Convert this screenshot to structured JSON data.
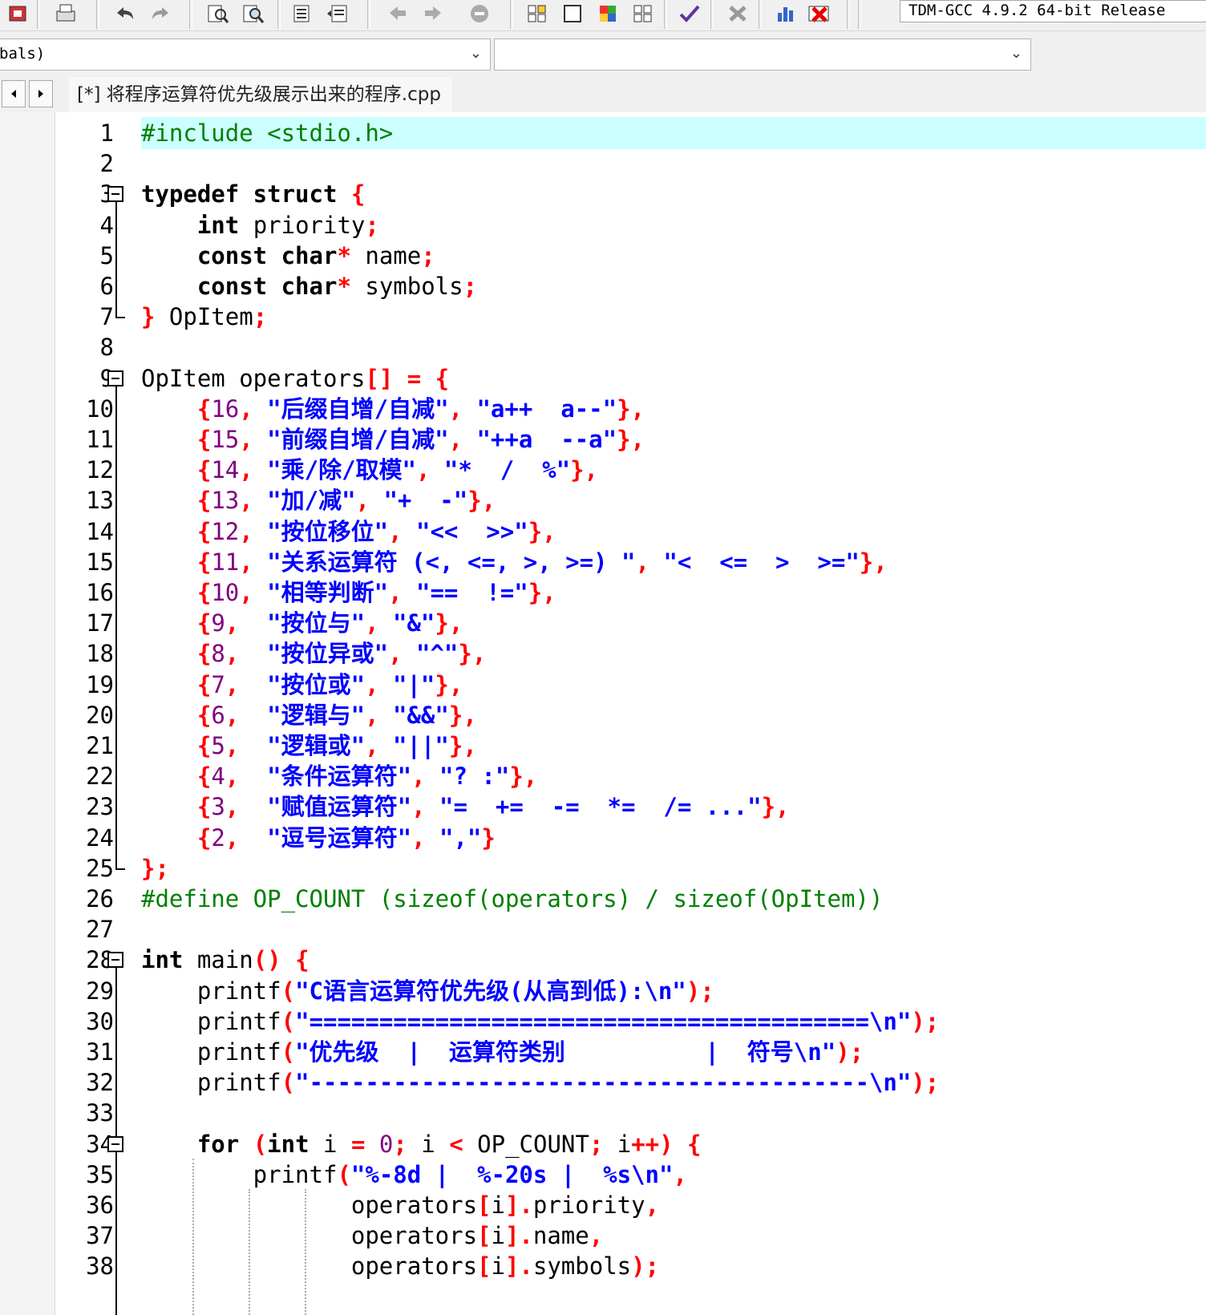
{
  "toolbar": {
    "compiler": "TDM-GCC 4.9.2 64-bit Release",
    "icons": [
      "new-project-icon",
      "print-icon",
      "undo-icon",
      "redo-icon",
      "find-icon",
      "replace-icon",
      "indent-icon",
      "unindent-icon",
      "bookmark-back-icon",
      "bookmark-forward-icon",
      "stop-icon",
      "new-class-icon",
      "window-icon",
      "color-grid-icon",
      "tile-icon",
      "check-syntax-icon",
      "close-x-icon",
      "chart-icon",
      "delete-red-icon"
    ]
  },
  "scope": {
    "left_value": "bals)",
    "right_value": ""
  },
  "tab": {
    "title": "[*] 将程序运算符优先级展示出来的程序.cpp"
  },
  "colors": {
    "keyword": "#000000",
    "symbol": "#ff0000",
    "number": "#800080",
    "string": "#0000ff",
    "preprocessor": "#008000",
    "current_line": "#ccffff"
  },
  "code": {
    "line_numbers": [
      "1",
      "2",
      "3",
      "4",
      "5",
      "6",
      "7",
      "8",
      "9",
      "10",
      "11",
      "12",
      "13",
      "14",
      "15",
      "16",
      "17",
      "18",
      "19",
      "20",
      "21",
      "22",
      "23",
      "24",
      "25",
      "26",
      "27",
      "28",
      "29",
      "30",
      "31",
      "32",
      "33",
      "34",
      "35",
      "36",
      "37",
      "38"
    ],
    "lines": [
      [
        [
          "pre",
          "#include <stdio.h>"
        ]
      ],
      [],
      [
        [
          "kw",
          "typedef struct "
        ],
        [
          "sym",
          "{"
        ]
      ],
      [
        [
          "txt",
          "    "
        ],
        [
          "kw",
          "int"
        ],
        [
          "txt",
          " priority"
        ],
        [
          "sym",
          ";"
        ]
      ],
      [
        [
          "txt",
          "    "
        ],
        [
          "kw",
          "const char"
        ],
        [
          "sym",
          "*"
        ],
        [
          "txt",
          " name"
        ],
        [
          "sym",
          ";"
        ]
      ],
      [
        [
          "txt",
          "    "
        ],
        [
          "kw",
          "const char"
        ],
        [
          "sym",
          "*"
        ],
        [
          "txt",
          " symbols"
        ],
        [
          "sym",
          ";"
        ]
      ],
      [
        [
          "sym",
          "}"
        ],
        [
          "txt",
          " OpItem"
        ],
        [
          "sym",
          ";"
        ]
      ],
      [],
      [
        [
          "txt",
          "OpItem operators"
        ],
        [
          "sym",
          "[] = {"
        ]
      ],
      [
        [
          "txt",
          "    "
        ],
        [
          "sym",
          "{"
        ],
        [
          "num",
          "16"
        ],
        [
          "sym",
          ", "
        ],
        [
          "str",
          "\"后缀自增/自减\""
        ],
        [
          "sym",
          ", "
        ],
        [
          "str",
          "\"a++  a--\""
        ],
        [
          "sym",
          "},"
        ]
      ],
      [
        [
          "txt",
          "    "
        ],
        [
          "sym",
          "{"
        ],
        [
          "num",
          "15"
        ],
        [
          "sym",
          ", "
        ],
        [
          "str",
          "\"前缀自增/自减\""
        ],
        [
          "sym",
          ", "
        ],
        [
          "str",
          "\"++a  --a\""
        ],
        [
          "sym",
          "},"
        ]
      ],
      [
        [
          "txt",
          "    "
        ],
        [
          "sym",
          "{"
        ],
        [
          "num",
          "14"
        ],
        [
          "sym",
          ", "
        ],
        [
          "str",
          "\"乘/除/取模\""
        ],
        [
          "sym",
          ", "
        ],
        [
          "str",
          "\"*  /  %\""
        ],
        [
          "sym",
          "},"
        ]
      ],
      [
        [
          "txt",
          "    "
        ],
        [
          "sym",
          "{"
        ],
        [
          "num",
          "13"
        ],
        [
          "sym",
          ", "
        ],
        [
          "str",
          "\"加/减\""
        ],
        [
          "sym",
          ", "
        ],
        [
          "str",
          "\"+  -\""
        ],
        [
          "sym",
          "},"
        ]
      ],
      [
        [
          "txt",
          "    "
        ],
        [
          "sym",
          "{"
        ],
        [
          "num",
          "12"
        ],
        [
          "sym",
          ", "
        ],
        [
          "str",
          "\"按位移位\""
        ],
        [
          "sym",
          ", "
        ],
        [
          "str",
          "\"<<  >>\""
        ],
        [
          "sym",
          "},"
        ]
      ],
      [
        [
          "txt",
          "    "
        ],
        [
          "sym",
          "{"
        ],
        [
          "num",
          "11"
        ],
        [
          "sym",
          ", "
        ],
        [
          "str",
          "\"关系运算符 (<, <=, >, >=) \""
        ],
        [
          "sym",
          ", "
        ],
        [
          "str",
          "\"<  <=  >  >=\""
        ],
        [
          "sym",
          "},"
        ]
      ],
      [
        [
          "txt",
          "    "
        ],
        [
          "sym",
          "{"
        ],
        [
          "num",
          "10"
        ],
        [
          "sym",
          ", "
        ],
        [
          "str",
          "\"相等判断\""
        ],
        [
          "sym",
          ", "
        ],
        [
          "str",
          "\"==  !=\""
        ],
        [
          "sym",
          "},"
        ]
      ],
      [
        [
          "txt",
          "    "
        ],
        [
          "sym",
          "{"
        ],
        [
          "num",
          "9"
        ],
        [
          "sym",
          ",  "
        ],
        [
          "str",
          "\"按位与\""
        ],
        [
          "sym",
          ", "
        ],
        [
          "str",
          "\"&\""
        ],
        [
          "sym",
          "},"
        ]
      ],
      [
        [
          "txt",
          "    "
        ],
        [
          "sym",
          "{"
        ],
        [
          "num",
          "8"
        ],
        [
          "sym",
          ",  "
        ],
        [
          "str",
          "\"按位异或\""
        ],
        [
          "sym",
          ", "
        ],
        [
          "str",
          "\"^\""
        ],
        [
          "sym",
          "},"
        ]
      ],
      [
        [
          "txt",
          "    "
        ],
        [
          "sym",
          "{"
        ],
        [
          "num",
          "7"
        ],
        [
          "sym",
          ",  "
        ],
        [
          "str",
          "\"按位或\""
        ],
        [
          "sym",
          ", "
        ],
        [
          "str",
          "\"|\""
        ],
        [
          "sym",
          "},"
        ]
      ],
      [
        [
          "txt",
          "    "
        ],
        [
          "sym",
          "{"
        ],
        [
          "num",
          "6"
        ],
        [
          "sym",
          ",  "
        ],
        [
          "str",
          "\"逻辑与\""
        ],
        [
          "sym",
          ", "
        ],
        [
          "str",
          "\"&&\""
        ],
        [
          "sym",
          "},"
        ]
      ],
      [
        [
          "txt",
          "    "
        ],
        [
          "sym",
          "{"
        ],
        [
          "num",
          "5"
        ],
        [
          "sym",
          ",  "
        ],
        [
          "str",
          "\"逻辑或\""
        ],
        [
          "sym",
          ", "
        ],
        [
          "str",
          "\"||\""
        ],
        [
          "sym",
          "},"
        ]
      ],
      [
        [
          "txt",
          "    "
        ],
        [
          "sym",
          "{"
        ],
        [
          "num",
          "4"
        ],
        [
          "sym",
          ",  "
        ],
        [
          "str",
          "\"条件运算符\""
        ],
        [
          "sym",
          ", "
        ],
        [
          "str",
          "\"? :\""
        ],
        [
          "sym",
          "},"
        ]
      ],
      [
        [
          "txt",
          "    "
        ],
        [
          "sym",
          "{"
        ],
        [
          "num",
          "3"
        ],
        [
          "sym",
          ",  "
        ],
        [
          "str",
          "\"赋值运算符\""
        ],
        [
          "sym",
          ", "
        ],
        [
          "str",
          "\"=  +=  -=  *=  /= ...\""
        ],
        [
          "sym",
          "},"
        ]
      ],
      [
        [
          "txt",
          "    "
        ],
        [
          "sym",
          "{"
        ],
        [
          "num",
          "2"
        ],
        [
          "sym",
          ",  "
        ],
        [
          "str",
          "\"逗号运算符\""
        ],
        [
          "sym",
          ", "
        ],
        [
          "str",
          "\",\""
        ],
        [
          "sym",
          "}"
        ]
      ],
      [
        [
          "sym",
          "};"
        ]
      ],
      [
        [
          "pre",
          "#define OP_COUNT (sizeof(operators) / sizeof(OpItem))"
        ]
      ],
      [],
      [
        [
          "kw",
          "int"
        ],
        [
          "txt",
          " main"
        ],
        [
          "sym",
          "() {"
        ]
      ],
      [
        [
          "txt",
          "    printf"
        ],
        [
          "sym",
          "("
        ],
        [
          "str",
          "\"C语言运算符优先级(从高到低):\\n\""
        ],
        [
          "sym",
          ");"
        ]
      ],
      [
        [
          "txt",
          "    printf"
        ],
        [
          "sym",
          "("
        ],
        [
          "str",
          "\"========================================\\n\""
        ],
        [
          "sym",
          ");"
        ]
      ],
      [
        [
          "txt",
          "    printf"
        ],
        [
          "sym",
          "("
        ],
        [
          "str",
          "\"优先级  |  运算符类别          |  符号\\n\""
        ],
        [
          "sym",
          ");"
        ]
      ],
      [
        [
          "txt",
          "    printf"
        ],
        [
          "sym",
          "("
        ],
        [
          "str",
          "\"----------------------------------------\\n\""
        ],
        [
          "sym",
          ");"
        ]
      ],
      [],
      [
        [
          "txt",
          "    "
        ],
        [
          "kw",
          "for"
        ],
        [
          "txt",
          " "
        ],
        [
          "sym",
          "("
        ],
        [
          "kw",
          "int"
        ],
        [
          "txt",
          " i "
        ],
        [
          "sym",
          "="
        ],
        [
          "txt",
          " "
        ],
        [
          "num",
          "0"
        ],
        [
          "sym",
          ";"
        ],
        [
          "txt",
          " i "
        ],
        [
          "sym",
          "<"
        ],
        [
          "txt",
          " OP_COUNT"
        ],
        [
          "sym",
          ";"
        ],
        [
          "txt",
          " i"
        ],
        [
          "sym",
          "++) {"
        ]
      ],
      [
        [
          "txt",
          "        printf"
        ],
        [
          "sym",
          "("
        ],
        [
          "str",
          "\"%-8d |  %-20s |  %s\\n\""
        ],
        [
          "sym",
          ","
        ]
      ],
      [
        [
          "txt",
          "               operators"
        ],
        [
          "sym",
          "["
        ],
        [
          "txt",
          "i"
        ],
        [
          "sym",
          "]."
        ],
        [
          "txt",
          "priority"
        ],
        [
          "sym",
          ","
        ]
      ],
      [
        [
          "txt",
          "               operators"
        ],
        [
          "sym",
          "["
        ],
        [
          "txt",
          "i"
        ],
        [
          "sym",
          "]."
        ],
        [
          "txt",
          "name"
        ],
        [
          "sym",
          ","
        ]
      ],
      [
        [
          "txt",
          "               operators"
        ],
        [
          "sym",
          "["
        ],
        [
          "txt",
          "i"
        ],
        [
          "sym",
          "]."
        ],
        [
          "txt",
          "symbols"
        ],
        [
          "sym",
          ");"
        ]
      ]
    ]
  }
}
